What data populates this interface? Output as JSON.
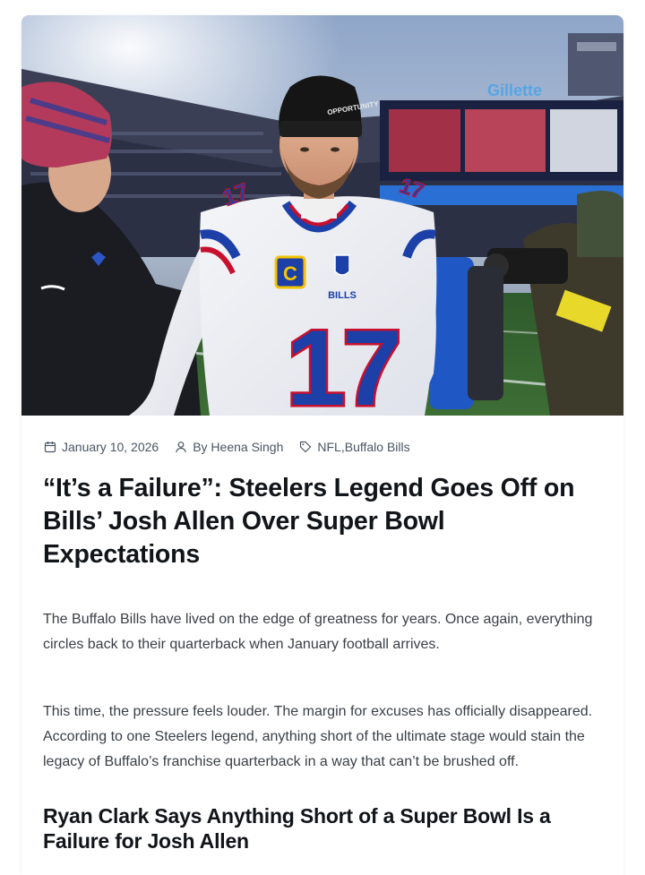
{
  "hero": {
    "jersey_number": "17",
    "team_wordmark": "BILLS",
    "beanie_text": "OPPORTUNITY",
    "captain_patch": "C",
    "stadium_sign": "Gillette"
  },
  "meta": {
    "date": "January 10, 2026",
    "author": "By Heena Singh",
    "categories": "NFL,Buffalo Bills"
  },
  "article": {
    "title": "“It’s a Failure”: Steelers Legend Goes Off on Bills’ Josh Allen Over Super Bowl Expectations",
    "paragraph_1": "The Buffalo Bills have lived on the edge of greatness for years. Once again, everything circles back to their quarterback when January football arrives.",
    "paragraph_2": "This time, the pressure feels louder. The margin for excuses has officially disappeared. According to one Steelers legend, anything short of the ultimate stage would stain the legacy of Buffalo’s franchise quarterback in a way that can’t be brushed off.",
    "subheading": "Ryan Clark Says Anything Short of a Super Bowl Is a Failure for Josh Allen"
  },
  "colors": {
    "bills_blue": "#1c3fa8",
    "bills_red": "#c8102e",
    "text_dark": "#111418",
    "text_body": "#3a3f45",
    "text_meta": "#4b5563"
  }
}
